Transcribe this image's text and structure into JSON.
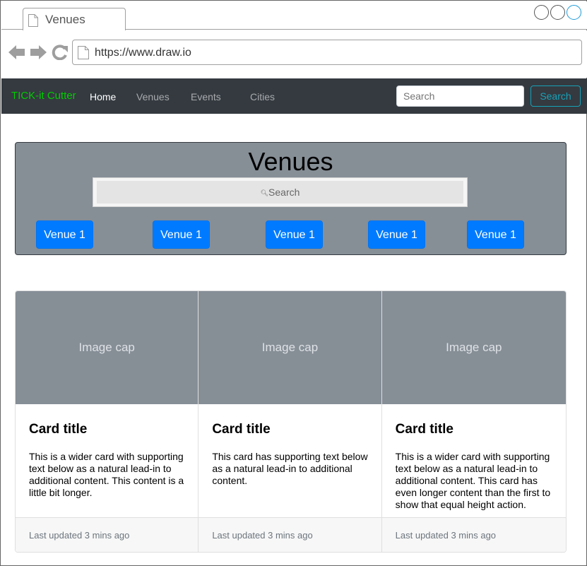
{
  "browser": {
    "tab_title": "Venues",
    "url": "https://www.draw.io"
  },
  "navbar": {
    "brand": "TICK-it Cutter",
    "links": [
      {
        "label": "Home",
        "active": true
      },
      {
        "label": "Venues",
        "active": false
      },
      {
        "label": "Events",
        "active": false
      },
      {
        "label": "Cities",
        "active": false
      }
    ],
    "search_placeholder": "Search",
    "search_button": "Search"
  },
  "jumbotron": {
    "title": "Venues",
    "search_placeholder": "Search",
    "venue_buttons": [
      "Venue 1",
      "Venue 1",
      "Venue 1",
      "Venue 1",
      "Venue 1"
    ]
  },
  "cards": [
    {
      "image_caption": "Image cap",
      "title": "Card title",
      "text": "This is a wider card with supporting text below as a natural lead-in to additional content. This content is a little bit longer.",
      "footer": "Last updated 3 mins ago"
    },
    {
      "image_caption": "Image cap",
      "title": "Card title",
      "text": "This card has supporting text below as a natural lead-in to additional content.",
      "footer": "Last updated 3 mins ago"
    },
    {
      "image_caption": "Image cap",
      "title": "Card title",
      "text": "This is a wider card with supporting text below as a natural lead-in to additional content. This card has even longer content than the first to show that equal height action.",
      "footer": "Last updated 3 mins ago"
    }
  ],
  "colors": {
    "brand": "#00cc00",
    "navbar_bg": "#343a40",
    "primary": "#007bff",
    "info": "#17a2b8",
    "jumbotron_bg": "#868e96"
  }
}
